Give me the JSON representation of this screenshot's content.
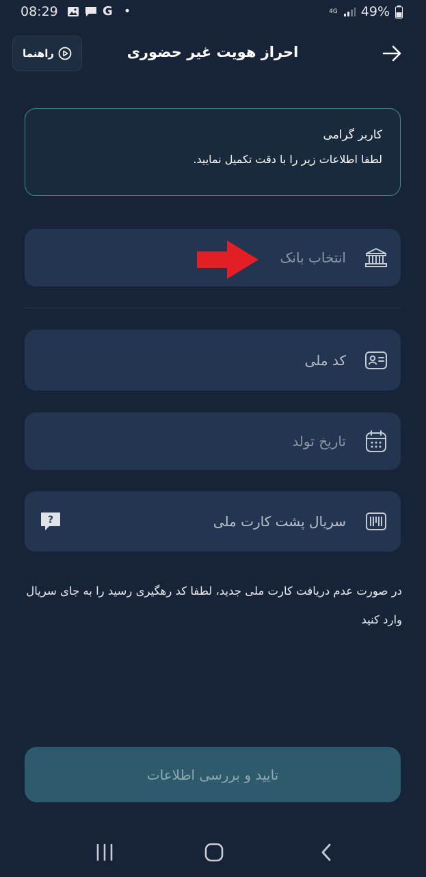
{
  "status_bar": {
    "time": "08:29",
    "network": "4G",
    "battery": "49%",
    "google_letter": "G",
    "dot": "•"
  },
  "header": {
    "guide_label": "راهنما",
    "title": "احراز هویت غیر حضوری"
  },
  "info_box": {
    "title": "کاربر گرامی",
    "text": "لطفا اطلاعات زیر را با دقت تکمیل نمایید."
  },
  "form": {
    "bank": {
      "label": "انتخاب بانک",
      "icon": "bank-icon"
    },
    "national_code": {
      "label": "کد ملی",
      "icon": "id-card-icon"
    },
    "birth_date": {
      "label": "تاریخ تولد",
      "icon": "calendar-icon"
    },
    "card_serial": {
      "label": "سریال پشت کارت ملی",
      "icon": "barcode-icon",
      "help_icon": "question-icon"
    }
  },
  "note": "در صورت عدم دریافت کارت ملی جدید، لطفا کد رهگیری رسید را به جای سریال وارد کنید",
  "submit_label": "تایید و بررسی اطلاعات",
  "colors": {
    "background": "#172336",
    "field": "#233550",
    "accent_border": "#3f8b92",
    "submit": "#2d5b6b",
    "arrow": "#e31e24"
  }
}
